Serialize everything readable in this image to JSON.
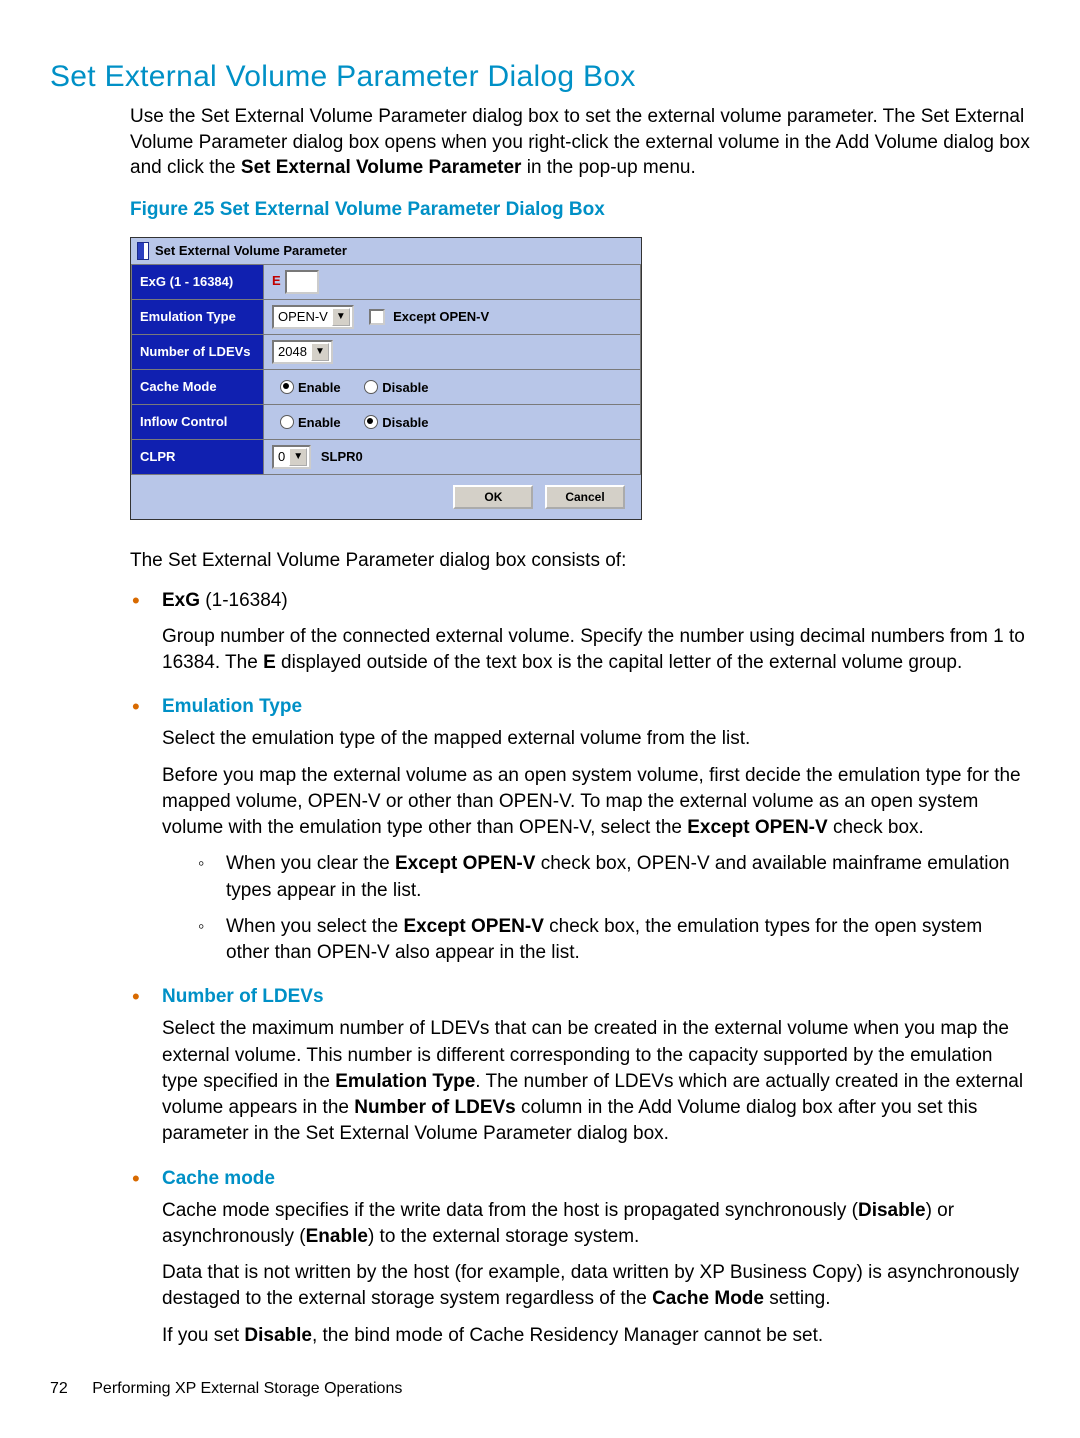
{
  "heading": "Set External Volume Parameter Dialog Box",
  "intro_parts": {
    "a": "Use the Set External Volume Parameter dialog box to set the external volume parameter. The Set External Volume Parameter dialog box opens when you right-click the external volume in the Add Volume dialog box and click the ",
    "b": "Set External Volume Parameter",
    "c": " in the pop-up menu."
  },
  "figure_caption": "Figure 25 Set External Volume Parameter Dialog Box",
  "dialog": {
    "title": "Set External Volume Parameter",
    "rows": {
      "exg": {
        "label": "ExG (1 - 16384)",
        "prefix": "E",
        "value": ""
      },
      "emu": {
        "label": "Emulation Type",
        "selected": "OPEN-V",
        "checkbox_label": "Except OPEN-V"
      },
      "ldev": {
        "label": "Number of LDEVs",
        "selected": "2048"
      },
      "cache": {
        "label": "Cache Mode",
        "enable": "Enable",
        "disable": "Disable",
        "selected": "enable"
      },
      "inflow": {
        "label": "Inflow Control",
        "enable": "Enable",
        "disable": "Disable",
        "selected": "disable"
      },
      "clpr": {
        "label": "CLPR",
        "selected": "0",
        "text": "SLPR0"
      }
    },
    "buttons": {
      "ok": "OK",
      "cancel": "Cancel"
    }
  },
  "consists": "The Set External Volume Parameter dialog box consists of:",
  "items": {
    "exg": {
      "term": "ExG",
      "range": " (1-16384)",
      "p1a": "Group number of the connected external volume. Specify the number using decimal numbers from 1 to 16384. The ",
      "p1b": "E",
      "p1c": " displayed outside of the text box is the capital letter of the external volume group."
    },
    "emu": {
      "heading": "Emulation Type",
      "p1": "Select the emulation type of the mapped external volume from the list.",
      "p2a": "Before you map the external volume as an open system volume, first decide the emulation type for the mapped volume, OPEN-V or other than OPEN-V. To map the external volume as an open system volume with the emulation type other than OPEN-V, select the ",
      "p2b": "Except OPEN-V",
      "p2c": " check box.",
      "sub1a": "When you clear the ",
      "sub1b": "Except OPEN-V",
      "sub1c": " check box, OPEN-V and available mainframe emulation types appear in the list.",
      "sub2a": "When you select the ",
      "sub2b": "Except OPEN-V",
      "sub2c": " check box, the emulation types for the open system other than OPEN-V also appear in the list."
    },
    "ldev": {
      "heading": "Number of LDEVs",
      "p1a": "Select the maximum number of LDEVs that can be created in the external volume when you map the external volume. This number is different corresponding to the capacity supported by the emulation type specified in the ",
      "p1b": "Emulation Type",
      "p1c": ". The number of LDEVs which are actually created in the external volume appears in the ",
      "p1d": "Number of LDEVs",
      "p1e": " column in the Add Volume dialog box after you set this parameter in the Set External Volume Parameter dialog box."
    },
    "cache": {
      "heading": "Cache mode",
      "p1a": "Cache mode specifies if the write data from the host is propagated synchronously (",
      "p1b": "Disable",
      "p1c": ") or asynchronously (",
      "p1d": "Enable",
      "p1e": ") to the external storage system.",
      "p2a": "Data that is not written by the host (for example, data written by XP Business Copy) is asynchronously destaged to the external storage system regardless of the ",
      "p2b": "Cache Mode",
      "p2c": " setting.",
      "p3a": "If you set ",
      "p3b": "Disable",
      "p3c": ", the bind mode of Cache Residency Manager cannot be set."
    }
  },
  "footer": {
    "page": "72",
    "text": "Performing XP External Storage Operations"
  }
}
